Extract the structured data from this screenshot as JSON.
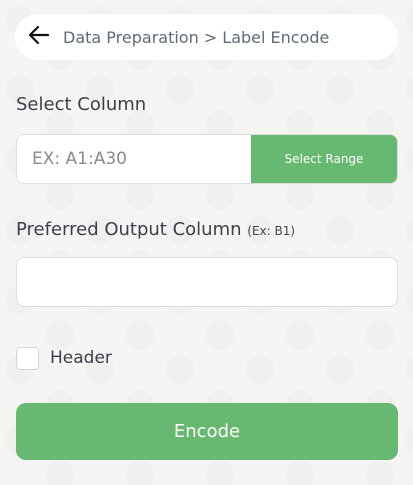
{
  "header": {
    "back_icon": "arrow-left-icon",
    "breadcrumb": "Data Preparation > Label Encode"
  },
  "select_column": {
    "label": "Select Column",
    "placeholder": "EX: A1:A30",
    "value": "",
    "button_label": "Select Range"
  },
  "output_column": {
    "label": "Preferred Output Column",
    "hint": "(Ex: B1)",
    "value": ""
  },
  "header_option": {
    "label": "Header",
    "checked": false
  },
  "encode_button": {
    "label": "Encode"
  },
  "colors": {
    "accent": "#67b870",
    "background": "#f5f5f4",
    "text": "#3a3f4a"
  }
}
